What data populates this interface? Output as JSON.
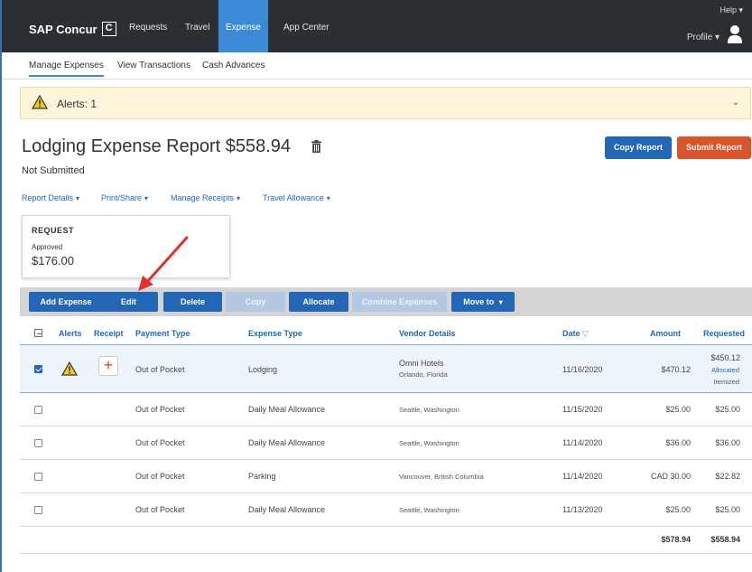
{
  "nav": {
    "logo": "SAP Concur",
    "logo_mark": "C",
    "items": [
      "Requests",
      "Travel",
      "Expense",
      "App Center"
    ],
    "active": "Expense",
    "help": "Help ▾",
    "profile": "Profile ▾"
  },
  "subnav": {
    "items": [
      "Manage Expenses",
      "View Transactions",
      "Cash Advances"
    ],
    "active": "Manage Expenses"
  },
  "alerts": {
    "label": "Alerts: 1"
  },
  "report": {
    "title": "Lodging Expense Report $558.94",
    "status": "Not Submitted",
    "copy_label": "Copy Report",
    "submit_label": "Submit Report"
  },
  "menus": [
    "Report Details",
    "Print/Share",
    "Manage Receipts",
    "Travel Allowance"
  ],
  "request_card": {
    "heading": "REQUEST",
    "status": "Approved",
    "amount": "$176.00"
  },
  "toolbar": {
    "add": "Add Expense",
    "edit": "Edit",
    "delete": "Delete",
    "copy": "Copy",
    "allocate": "Allocate",
    "combine": "Combine Expenses",
    "move": "Move to"
  },
  "columns": {
    "alerts": "Alerts",
    "receipt": "Receipt",
    "payment": "Payment Type",
    "expense": "Expense Type",
    "vendor": "Vendor Details",
    "date": "Date",
    "amount": "Amount",
    "requested": "Requested"
  },
  "rows": [
    {
      "payment": "Out of Pocket",
      "expense": "Lodging",
      "vendor": "Omni Hotels",
      "location": "Orlando, Florida",
      "date": "11/16/2020",
      "amount": "$470.12",
      "requested": "$450.12",
      "note1": "Allocated",
      "note2": "Itemized"
    },
    {
      "payment": "Out of Pocket",
      "expense": "Daily Meal Allowance",
      "location": "Seattle, Washington",
      "date": "11/15/2020",
      "amount": "$25.00",
      "requested": "$25.00"
    },
    {
      "payment": "Out of Pocket",
      "expense": "Daily Meal Allowance",
      "location": "Seattle, Washington",
      "date": "11/14/2020",
      "amount": "$36.00",
      "requested": "$36.00"
    },
    {
      "payment": "Out of Pocket",
      "expense": "Parking",
      "location": "Vancouver, British Columbia",
      "date": "11/14/2020",
      "amount": "CAD 30.00",
      "requested": "$22.82"
    },
    {
      "payment": "Out of Pocket",
      "expense": "Daily Meal Allowance",
      "location": "Seattle, Washington",
      "date": "11/13/2020",
      "amount": "$25.00",
      "requested": "$25.00"
    }
  ],
  "totals": {
    "amount": "$578.94",
    "requested": "$558.94"
  },
  "colors": {
    "nav_bg": "#2b2e33",
    "accent": "#2366b5",
    "submit": "#d9532b",
    "alert_bg": "#fdf5d9"
  }
}
